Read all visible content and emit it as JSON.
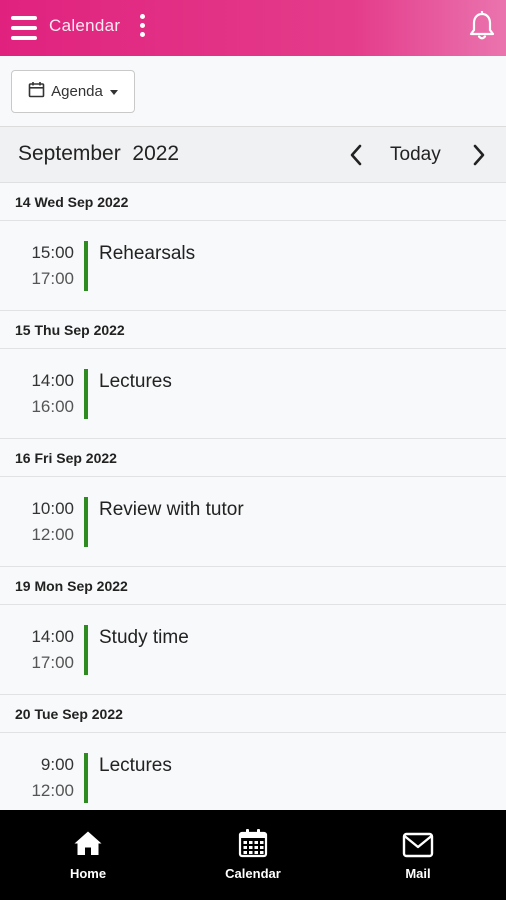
{
  "header": {
    "title": "Calendar",
    "icons": [
      "menu-icon",
      "more-vertical-icon",
      "bell-icon"
    ],
    "gradient_colors": [
      "#e0227e",
      "#ea74ae"
    ]
  },
  "toolbar": {
    "view_label": "Agenda",
    "view_icon": "calendar-icon"
  },
  "month_nav": {
    "month_label": "September  2022",
    "today_label": "Today",
    "prev_icon": "chevron-left-icon",
    "next_icon": "chevron-right-icon"
  },
  "agenda": {
    "event_color": "#2e8b1f",
    "days": [
      {
        "date": "14 Wed Sep 2022",
        "events": [
          {
            "start": "15:00",
            "end": "17:00",
            "title": "Rehearsals"
          }
        ]
      },
      {
        "date": "15 Thu Sep 2022",
        "events": [
          {
            "start": "14:00",
            "end": "16:00",
            "title": "Lectures"
          }
        ]
      },
      {
        "date": "16 Fri Sep 2022",
        "events": [
          {
            "start": "10:00",
            "end": "12:00",
            "title": "Review with tutor"
          }
        ]
      },
      {
        "date": "19 Mon Sep 2022",
        "events": [
          {
            "start": "14:00",
            "end": "17:00",
            "title": "Study time"
          }
        ]
      },
      {
        "date": "20 Tue Sep 2022",
        "events": [
          {
            "start": "9:00",
            "end": "12:00",
            "title": "Lectures"
          }
        ]
      }
    ]
  },
  "bottom_nav": {
    "items": [
      {
        "label": "Home",
        "icon": "home-icon"
      },
      {
        "label": "Calendar",
        "icon": "calendar-grid-icon"
      },
      {
        "label": "Mail",
        "icon": "mail-icon"
      }
    ]
  }
}
